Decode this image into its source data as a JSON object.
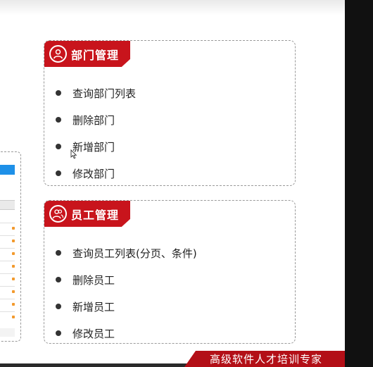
{
  "dept_card": {
    "title": "部门管理",
    "items": [
      "查询部门列表",
      "删除部门",
      "新增部门",
      "修改部门"
    ]
  },
  "emp_card": {
    "title": "员工管理",
    "items": [
      "查询员工列表(分页、条件)",
      "删除员工",
      "新增员工",
      "修改员工"
    ]
  },
  "banner": {
    "text": "高级软件人才培训专家"
  },
  "icons": {
    "dept": "user-icon",
    "emp": "users-icon"
  },
  "colors": {
    "accent": "#c8141c",
    "banner": "#b30f17",
    "preview_bar": "#1e90e8"
  }
}
